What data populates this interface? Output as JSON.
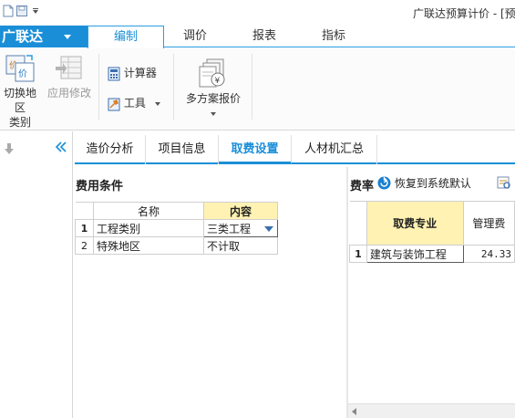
{
  "window": {
    "title": "广联达预算计价 - [预"
  },
  "app_menu": {
    "label": "广联达"
  },
  "ribbon_tabs": [
    {
      "label": "编制",
      "active": true
    },
    {
      "label": "调价",
      "active": false
    },
    {
      "label": "报表",
      "active": false
    },
    {
      "label": "指标",
      "active": false
    }
  ],
  "ribbon": {
    "switch_region": {
      "line1": "切换地区",
      "line2": "类别"
    },
    "apply_changes": {
      "label": "应用修改"
    },
    "calculator": {
      "label": "计算器"
    },
    "tools": {
      "label": "工具"
    },
    "multi_quote": {
      "label": "多方案报价"
    }
  },
  "content_tabs": [
    {
      "label": "造价分析",
      "active": false
    },
    {
      "label": "项目信息",
      "active": false
    },
    {
      "label": "取费设置",
      "active": true
    },
    {
      "label": "人材机汇总",
      "active": false
    }
  ],
  "fee_conditions": {
    "title": "费用条件",
    "columns": [
      "名称",
      "内容"
    ],
    "rows": [
      {
        "num": "1",
        "name": "工程类别",
        "value": "三类工程"
      },
      {
        "num": "2",
        "name": "特殊地区",
        "value": "不计取"
      }
    ]
  },
  "rates": {
    "title": "费率",
    "restore_label": "恢复到系统默认",
    "columns": [
      "取费专业",
      "管理费"
    ],
    "rows": [
      {
        "num": "1",
        "specialty": "建筑与装饰工程",
        "mgmt_fee": "24.33"
      }
    ]
  },
  "colors": {
    "accent": "#1a8fd8",
    "header_highlight": "#fff2b3"
  }
}
